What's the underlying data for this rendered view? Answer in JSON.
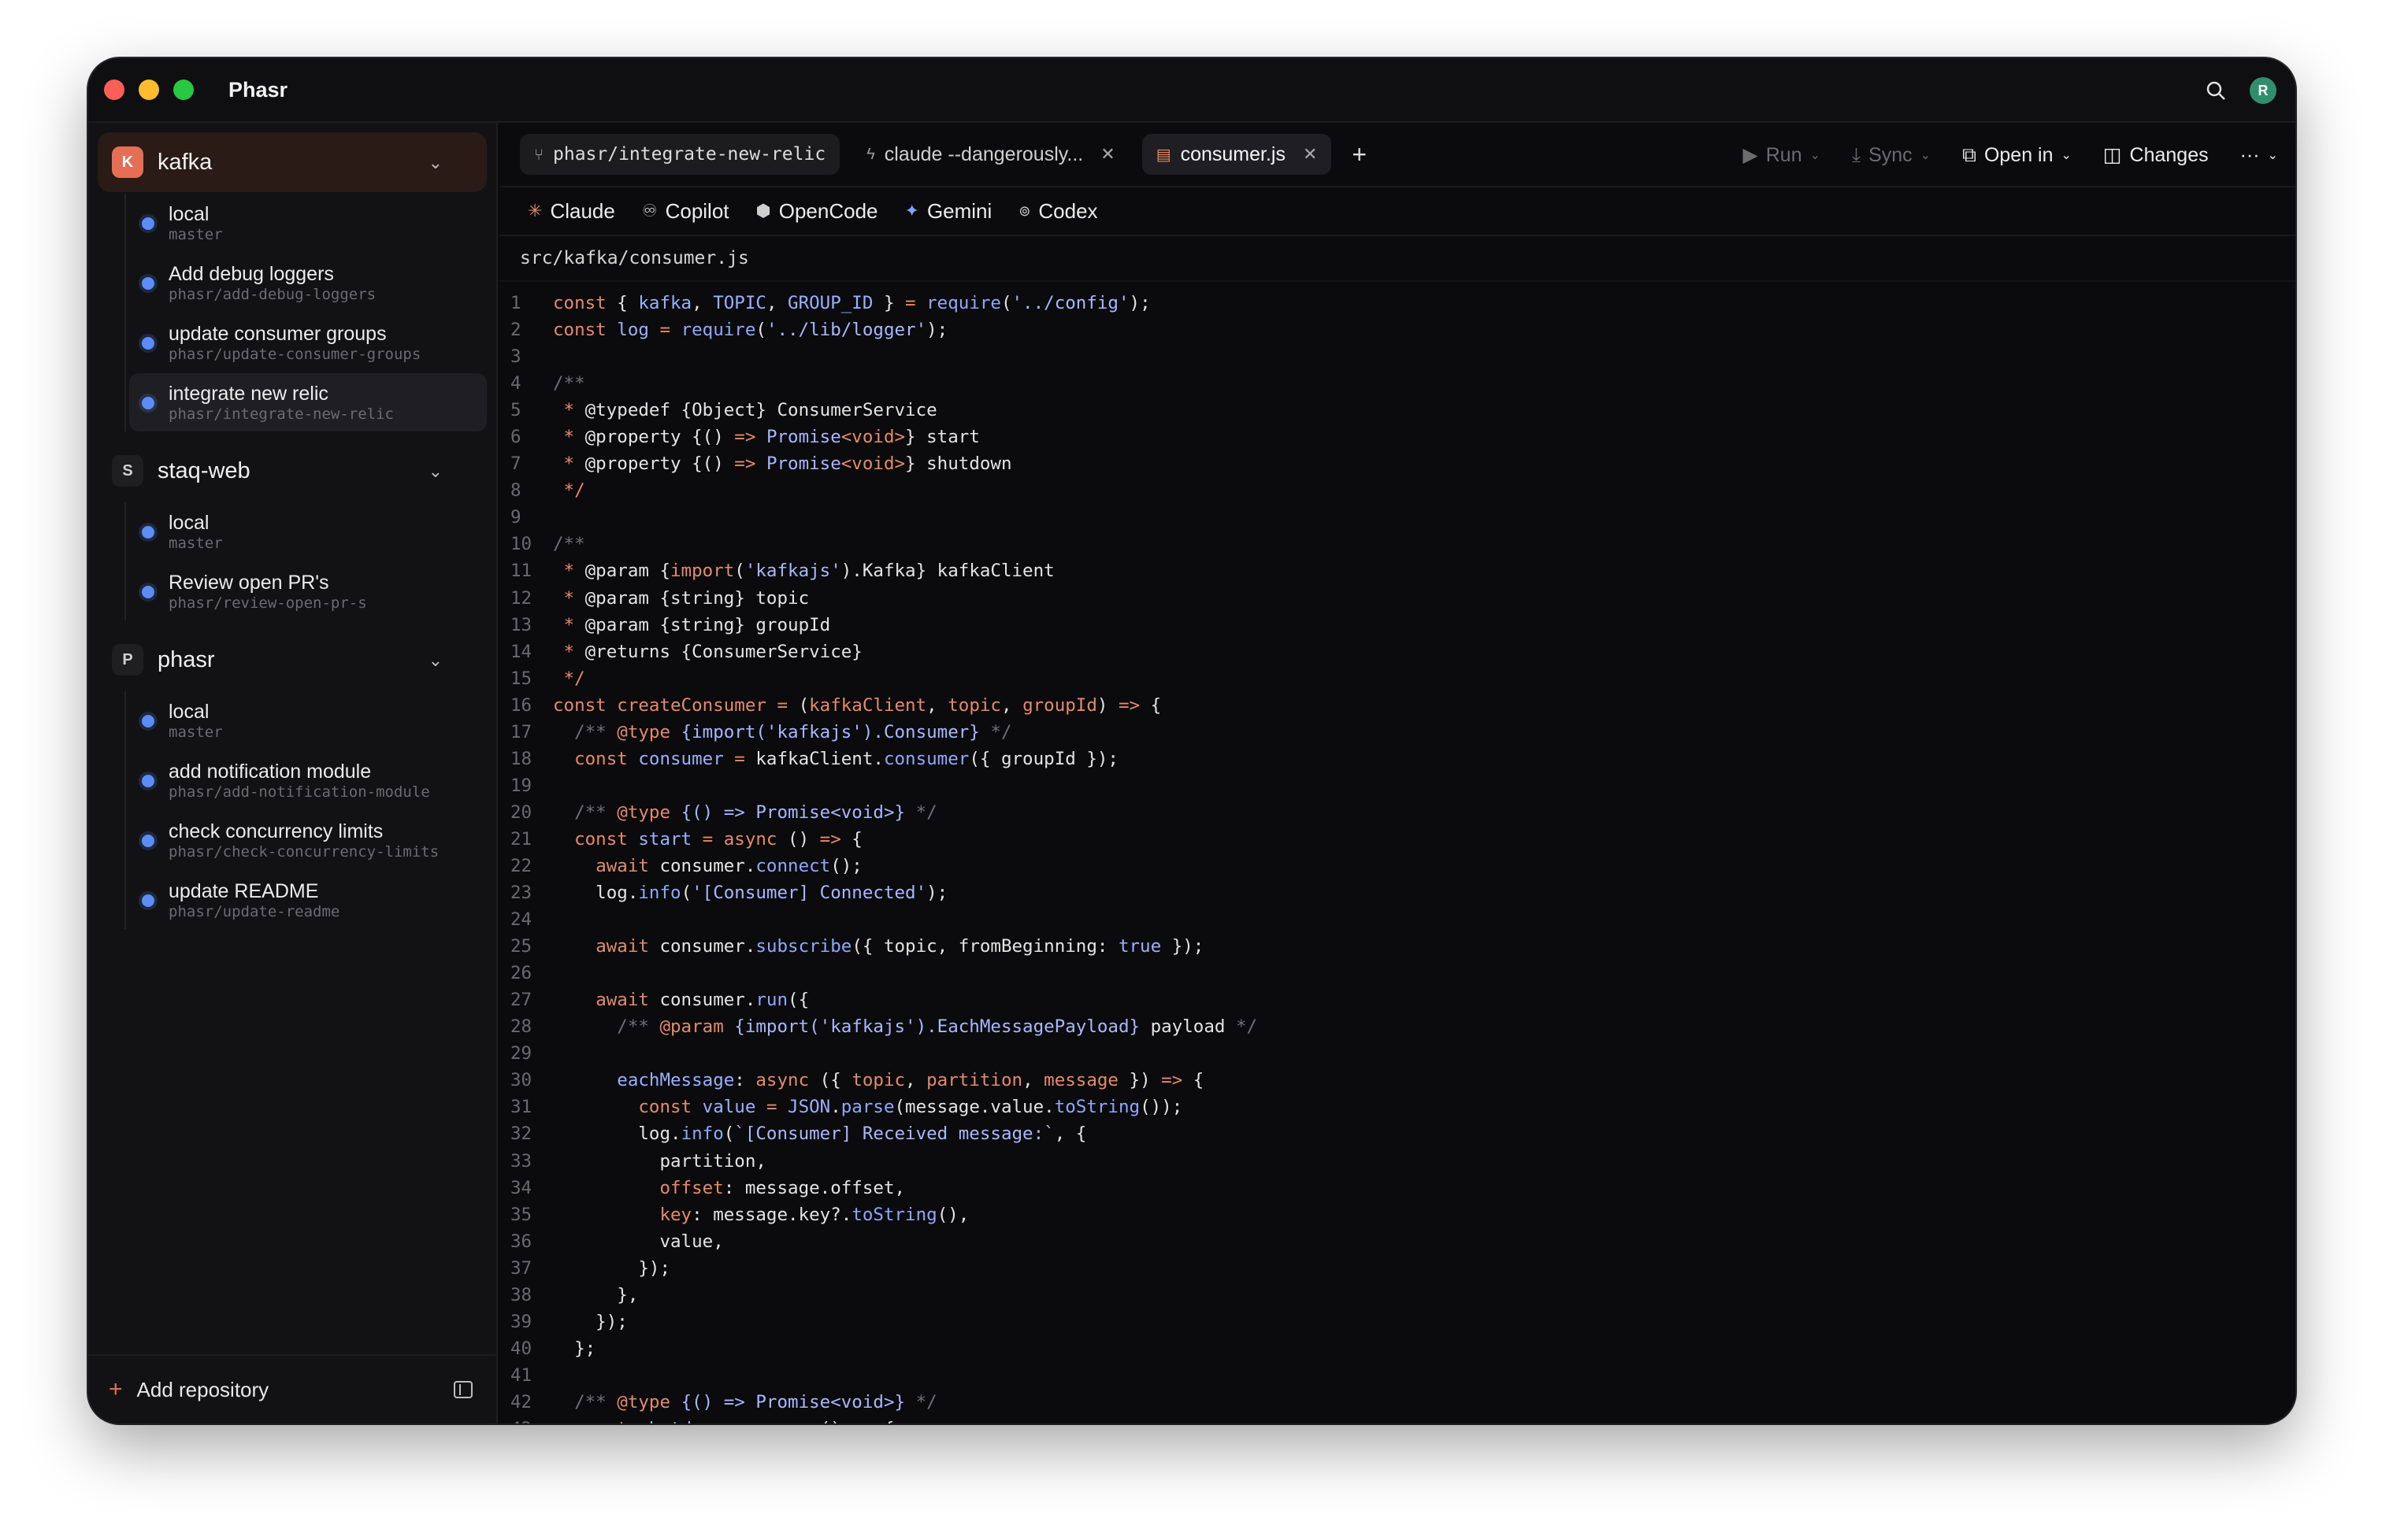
{
  "app": {
    "title": "Phasr",
    "avatar_initial": "R"
  },
  "sidebar": {
    "repos": [
      {
        "badge": "K",
        "name": "kafka",
        "branches": [
          {
            "title": "local",
            "sub": "master"
          },
          {
            "title": "Add debug loggers",
            "sub": "phasr/add-debug-loggers"
          },
          {
            "title": "update consumer groups",
            "sub": "phasr/update-consumer-groups"
          },
          {
            "title": "integrate new relic",
            "sub": "phasr/integrate-new-relic"
          }
        ]
      },
      {
        "badge": "S",
        "name": "staq-web",
        "branches": [
          {
            "title": "local",
            "sub": "master"
          },
          {
            "title": "Review open PR's",
            "sub": "phasr/review-open-pr-s"
          }
        ]
      },
      {
        "badge": "P",
        "name": "phasr",
        "branches": [
          {
            "title": "local",
            "sub": "master"
          },
          {
            "title": "add notification module",
            "sub": "phasr/add-notification-module"
          },
          {
            "title": "check concurrency limits",
            "sub": "phasr/check-concurrency-limits"
          },
          {
            "title": "update README",
            "sub": "phasr/update-readme"
          }
        ]
      }
    ],
    "footer_label": "Add repository"
  },
  "tabs": {
    "branch": "phasr/integrate-new-relic",
    "terminal": "claude --dangerously...",
    "file": "consumer.js"
  },
  "toolbar": {
    "run": "Run",
    "sync": "Sync",
    "open_in": "Open in",
    "changes": "Changes"
  },
  "agents": [
    "Claude",
    "Copilot",
    "OpenCode",
    "Gemini",
    "Codex"
  ],
  "file_path": "src/kafka/consumer.js"
}
